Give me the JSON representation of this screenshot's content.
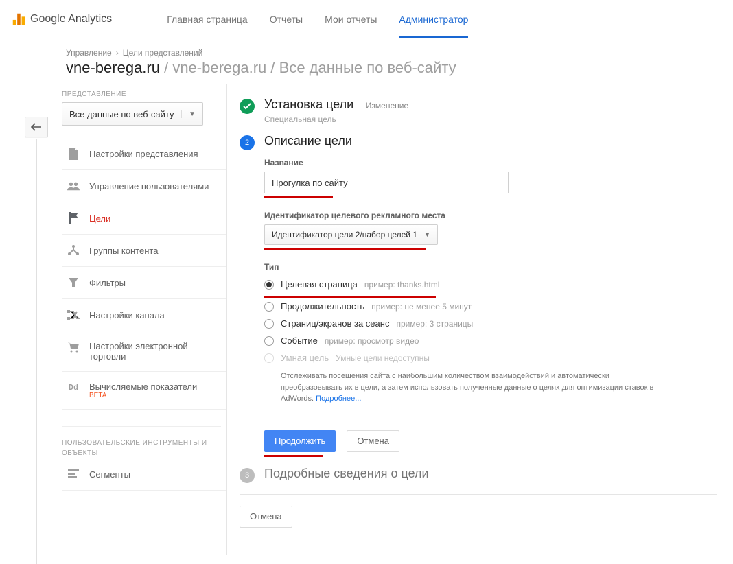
{
  "brand": {
    "google": "Google",
    "analytics": "Analytics"
  },
  "topnav": {
    "home": "Главная страница",
    "reports": "Отчеты",
    "my_reports": "Мои отчеты",
    "admin": "Администратор"
  },
  "crumbs": {
    "a": "Управление",
    "b": "Цели представлений"
  },
  "title": {
    "main": "vne-berega.ru",
    "mid": " / vne-berega.ru / ",
    "tail": "Все данные по веб-сайту"
  },
  "left": {
    "view_label": "ПРЕДСТАВЛЕНИЕ",
    "view_value": "Все данные по веб-сайту",
    "menu": {
      "settings": "Настройки представления",
      "users": "Управление пользователями",
      "goals": "Цели",
      "content": "Группы контента",
      "filters": "Фильтры",
      "channel": "Настройки канала",
      "ecomm": "Настройки электронной торговли",
      "calc": "Вычисляемые показатели",
      "calc_beta": "BETA",
      "section2": "ПОЛЬЗОВАТЕЛЬСКИЕ ИНСТРУМЕНТЫ И ОБЪЕКТЫ",
      "segments": "Сегменты"
    }
  },
  "steps": {
    "s1": {
      "title": "Установка цели",
      "edit": "Изменение",
      "sub": "Специальная цель"
    },
    "s2": {
      "title": "Описание цели",
      "name_label": "Название",
      "name_value": "Прогулка по сайту",
      "slot_label": "Идентификатор целевого рекламного места",
      "slot_value": "Идентификатор цели 2/набор целей 1",
      "type_label": "Тип",
      "types": {
        "dest": {
          "label": "Целевая страница",
          "hint": "пример: thanks.html"
        },
        "dur": {
          "label": "Продолжительность",
          "hint": "пример: не менее 5 минут"
        },
        "pps": {
          "label": "Страниц/экранов за сеанс",
          "hint": "пример: 3 страницы"
        },
        "evt": {
          "label": "Событие",
          "hint": "пример: просмотр видео"
        },
        "smart": {
          "label": "Умная цель",
          "hint": "Умные цели недоступны"
        }
      },
      "smart_desc": "Отслеживать посещения сайта с наибольшим количеством взаимодействий и автоматически преобразовывать их в цели, а затем использовать полученные данные о целях для оптимизации ставок в AdWords.",
      "smart_more": "Подробнее...",
      "continue": "Продолжить",
      "cancel": "Отмена"
    },
    "s3": {
      "num": "3",
      "title": "Подробные сведения о цели"
    },
    "global_cancel": "Отмена"
  }
}
